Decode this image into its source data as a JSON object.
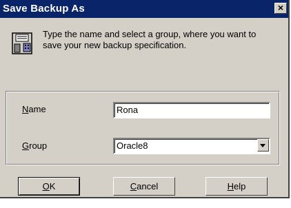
{
  "window": {
    "title": "Save Backup As",
    "close_glyph": "×"
  },
  "icon": {
    "name": "floppy-disk-icon"
  },
  "description": "Type the name and select a group, where you want to save your new backup specification.",
  "form": {
    "name": {
      "accel": "N",
      "rest": "ame",
      "value": "Rona"
    },
    "group": {
      "accel": "G",
      "rest": "roup",
      "selected": "Oracle8"
    }
  },
  "buttons": {
    "ok": {
      "accel": "O",
      "rest": "K"
    },
    "cancel": {
      "accel": "C",
      "rest": "ancel"
    },
    "help": {
      "accel": "H",
      "rest": "elp"
    }
  },
  "colors": {
    "titlebar": "#0a246a",
    "face": "#d4d0c8"
  }
}
